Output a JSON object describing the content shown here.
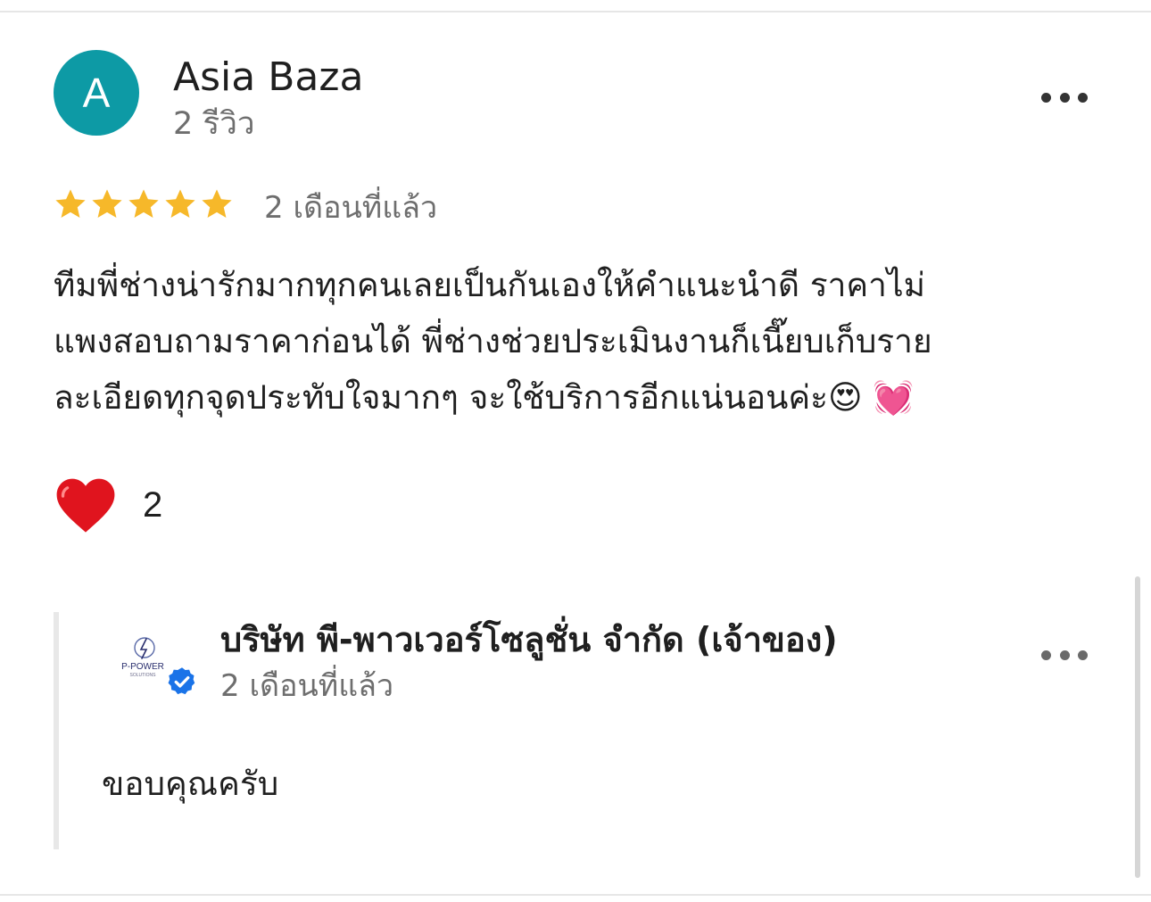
{
  "review": {
    "avatar_letter": "A",
    "reviewer_name": "Asia Baza",
    "reviewer_review_count": "2 รีวิว",
    "rating": 5,
    "rating_max": 5,
    "time_ago": "2 เดือนที่แล้ว",
    "text_lines": [
      "ทีมพี่ช่างน่ารักมากทุกคนเลยเป็นกันเองให้คำแนะนำดี  ราคาไม่",
      "แพงสอบถามราคาก่อนได้ พี่ช่างช่วยประเมินงานก็เนี๊ยบเก็บราย",
      "ละเอียดทุกจุดประทับใจมากๆ จะใช้บริการอีกแน่นอนค่ะ😍 💓"
    ],
    "reaction_count": "2"
  },
  "owner_reply": {
    "name": "บริษัท พี-พาวเวอร์โซลูชั่น จำกัด (เจ้าของ)",
    "time_ago": "2 เดือนที่แล้ว",
    "text": "ขอบคุณครับ",
    "logo_text": "P-POWER",
    "logo_subtext": "SOLUTIONS"
  },
  "colors": {
    "avatar_bg": "#0d9aa5",
    "star": "#f6b82a",
    "heart": "#e0141e",
    "verified": "#1a73e8"
  },
  "icons": {
    "more": "more-horizontal-icon",
    "star": "star-icon",
    "heart": "heart-icon",
    "verified": "verified-badge-icon"
  }
}
